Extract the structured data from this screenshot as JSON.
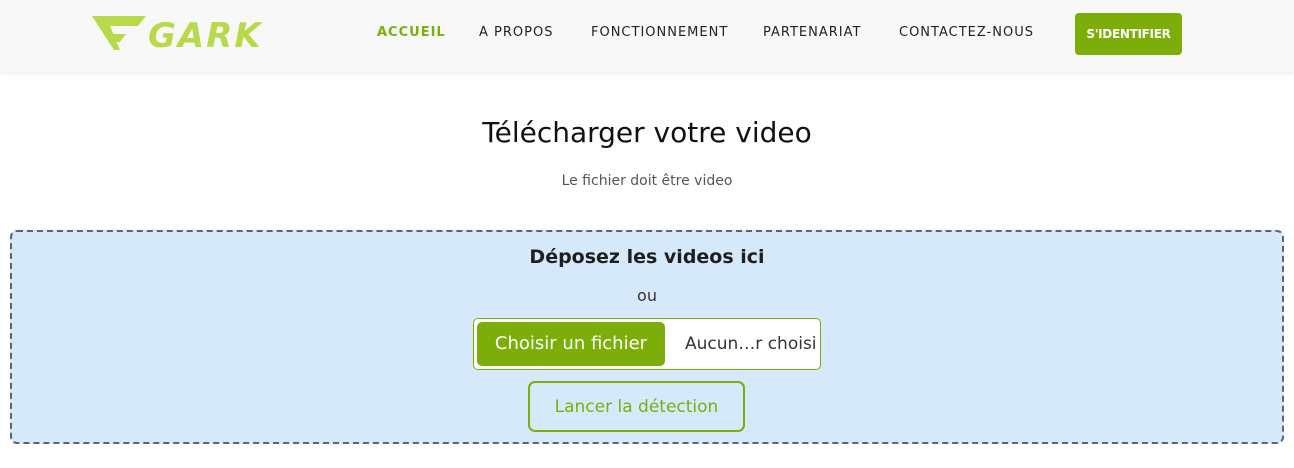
{
  "brand": {
    "name": "GARK",
    "color": "#b8d94a",
    "icon": "gark-logo-icon"
  },
  "nav": {
    "items": [
      {
        "label": "ACCUEIL",
        "active": true
      },
      {
        "label": "A PROPOS",
        "active": false
      },
      {
        "label": "FONCTIONNEMENT",
        "active": false
      },
      {
        "label": "PARTENARIAT",
        "active": false
      },
      {
        "label": "CONTACTEZ-NOUS",
        "active": false
      }
    ],
    "login_label": "S'IDENTIFIER"
  },
  "main": {
    "title": "Télécharger votre video",
    "subtitle": "Le fichier doit être video"
  },
  "dropzone": {
    "title": "Déposez les videos ici",
    "or_label": "ou",
    "file_button_label": "Choisir un fichier",
    "file_name": "Aucun…r choisi",
    "detect_label": "Lancer la détection"
  },
  "colors": {
    "accent": "#7cae0a",
    "logo": "#b8d94a",
    "dropzone_bg": "#d5e9fb",
    "nav_bg": "#f9f8f8"
  }
}
